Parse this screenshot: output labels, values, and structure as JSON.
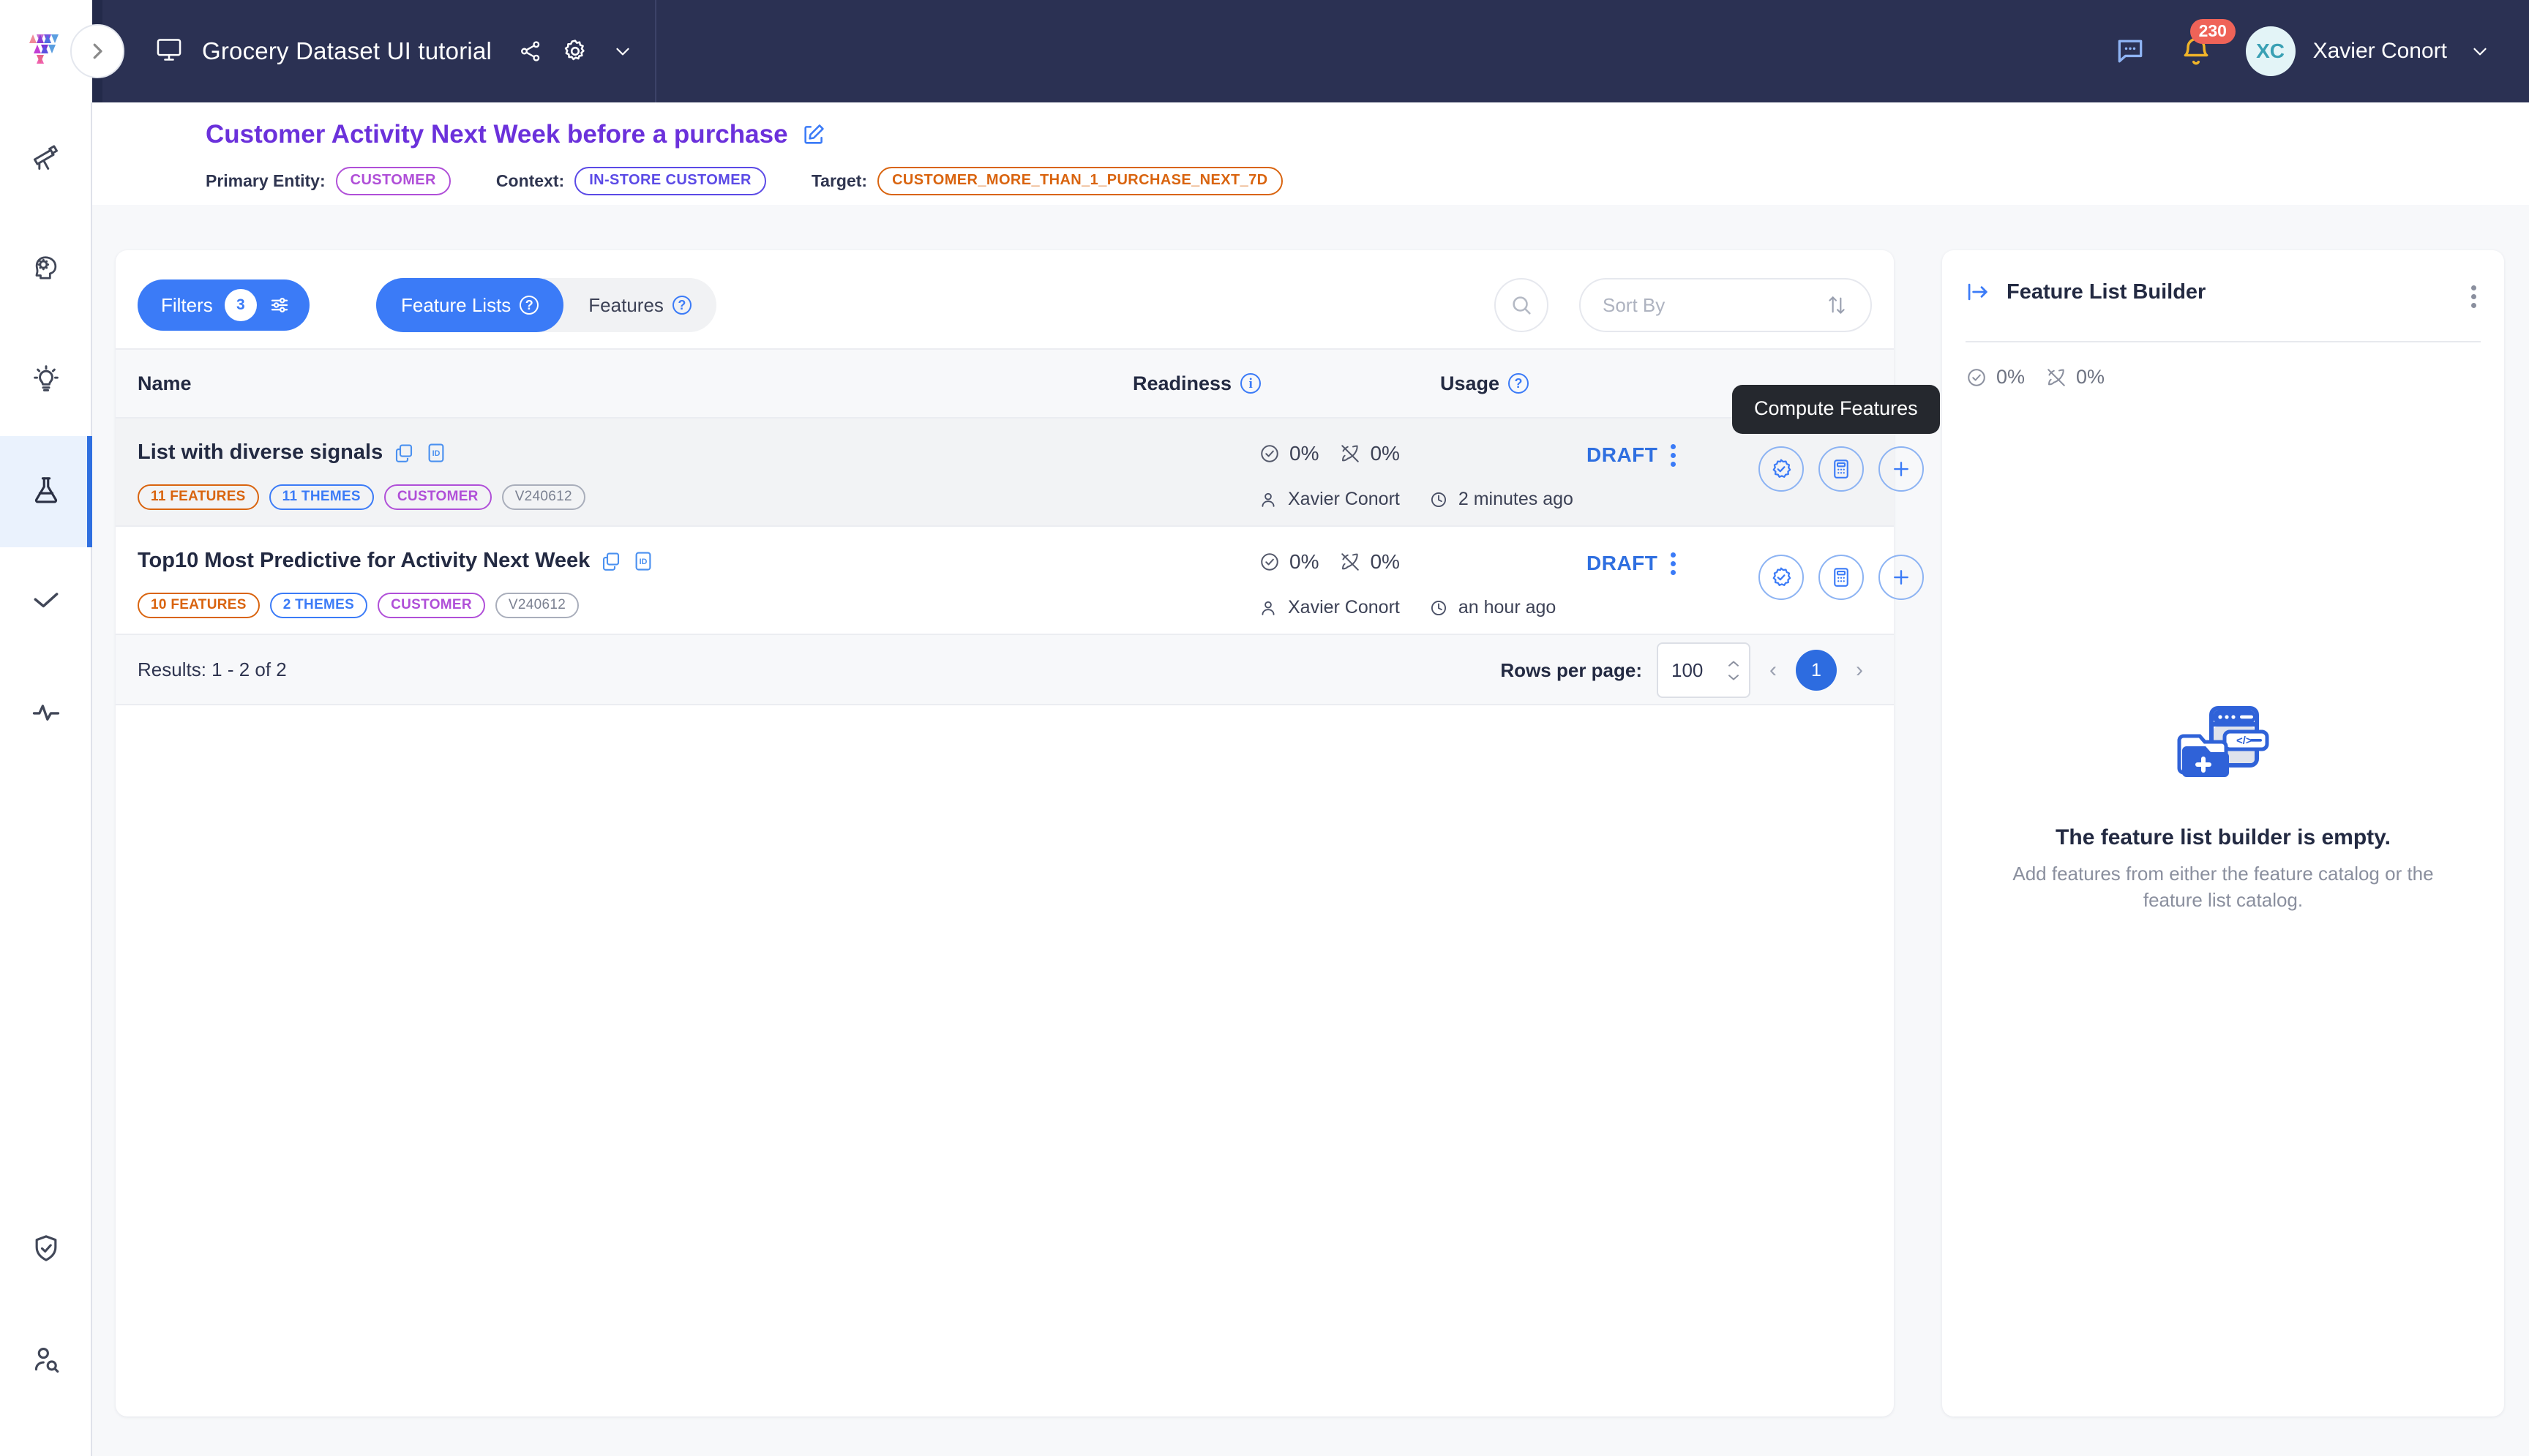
{
  "topbar": {
    "workspace_title": "Grocery Dataset UI tutorial",
    "monitor_icon": "monitor-icon",
    "share_icon": "share-icon",
    "settings_icon": "gear-icon",
    "caret_icon": "chevron-down-icon",
    "chat_icon": "chat-bubble-icon",
    "bell_icon": "bell-icon",
    "notification_count": "230",
    "avatar_initials": "XC",
    "user_name": "Xavier Conort",
    "bg_color": "#2b3153"
  },
  "rail": {
    "items": [
      {
        "icon": "telescope-icon",
        "active": false
      },
      {
        "icon": "brain-gear-icon",
        "active": false
      },
      {
        "icon": "lightbulb-icon",
        "active": false
      },
      {
        "icon": "flask-icon",
        "active": true
      },
      {
        "icon": "checkmark-icon",
        "active": false
      },
      {
        "icon": "pulse-icon",
        "active": false
      }
    ],
    "bottom_items": [
      {
        "icon": "shield-check-icon",
        "active": false
      },
      {
        "icon": "user-search-icon",
        "active": false
      }
    ]
  },
  "page_header": {
    "title": "Customer Activity Next Week before a purchase",
    "edit_icon": "edit-pencil-icon",
    "title_color": "#6b31db",
    "meta": [
      {
        "label": "Primary Entity:",
        "value": "CUSTOMER",
        "color": "#b04fd8"
      },
      {
        "label": "Context:",
        "value": "IN-STORE CUSTOMER",
        "color": "#5b4ae6"
      },
      {
        "label": "Target:",
        "value": "CUSTOMER_MORE_THAN_1_PURCHASE_NEXT_7D",
        "color": "#d9640f"
      }
    ]
  },
  "toolbar": {
    "filters_label": "Filters",
    "filters_count": "3",
    "filters_icon": "sliders-icon",
    "tabs": [
      {
        "label": "Feature Lists",
        "active": true,
        "help_icon": "question-circle-icon"
      },
      {
        "label": "Features",
        "active": false,
        "help_icon": "question-circle-icon"
      }
    ],
    "search_icon": "search-icon",
    "sort_placeholder": "Sort By",
    "sort_icon": "sort-arrows-icon",
    "accent_color": "#3b7bf7"
  },
  "table": {
    "columns": [
      {
        "label": "Name",
        "info_icon": null
      },
      {
        "label": "Readiness",
        "info_icon": "info-circle-icon"
      },
      {
        "label": "Usage",
        "info_icon": "question-circle-icon"
      }
    ],
    "rows": [
      {
        "name": "List with diverse signals",
        "copy_icon": "copy-icon",
        "id_icon": "id-badge-icon",
        "tags": [
          {
            "text": "11 FEATURES",
            "kind": "features"
          },
          {
            "text": "11 THEMES",
            "kind": "themes"
          },
          {
            "text": "CUSTOMER",
            "kind": "entity"
          },
          {
            "text": "V240612",
            "kind": "version"
          }
        ],
        "readiness": "0%",
        "readiness_icon": "check-circle-icon",
        "usage": "0%",
        "usage_icon": "rocket-off-icon",
        "status": "DRAFT",
        "author": "Xavier Conort",
        "author_icon": "person-icon",
        "time": "2 minutes ago",
        "time_icon": "clock-icon",
        "actions": [
          {
            "icon": "verified-badge-icon",
            "name": "validate-features-button"
          },
          {
            "icon": "calculator-icon",
            "name": "compute-features-button"
          },
          {
            "icon": "plus-icon",
            "name": "add-to-builder-button"
          }
        ],
        "highlighted": true
      },
      {
        "name": "Top10 Most Predictive for Activity Next Week",
        "copy_icon": "copy-icon",
        "id_icon": "id-badge-icon",
        "tags": [
          {
            "text": "10 FEATURES",
            "kind": "features"
          },
          {
            "text": "2 THEMES",
            "kind": "themes"
          },
          {
            "text": "CUSTOMER",
            "kind": "entity"
          },
          {
            "text": "V240612",
            "kind": "version"
          }
        ],
        "readiness": "0%",
        "readiness_icon": "check-circle-icon",
        "usage": "0%",
        "usage_icon": "rocket-off-icon",
        "status": "DRAFT",
        "author": "Xavier Conort",
        "author_icon": "person-icon",
        "time": "an hour ago",
        "time_icon": "clock-icon",
        "actions": [
          {
            "icon": "verified-badge-icon",
            "name": "validate-features-button"
          },
          {
            "icon": "calculator-icon",
            "name": "compute-features-button"
          },
          {
            "icon": "plus-icon",
            "name": "add-to-builder-button"
          }
        ],
        "highlighted": false
      }
    ],
    "tooltip": "Compute Features",
    "footer": {
      "results": "Results: 1 - 2 of 2",
      "rows_per_page_label": "Rows per page:",
      "rows_per_page_value": "100",
      "prev_icon": "chevron-left-icon",
      "next_icon": "chevron-right-icon",
      "current_page": "1"
    }
  },
  "builder": {
    "collapse_icon": "panel-collapse-icon",
    "title": "Feature List Builder",
    "kebab_icon": "more-vertical-icon",
    "readiness": "0%",
    "readiness_icon": "check-circle-icon",
    "usage": "0%",
    "usage_icon": "rocket-off-icon",
    "empty_illustration": "empty-folder-code-icon",
    "empty_title": "The feature list builder is empty.",
    "empty_subtitle": "Add features from either the feature catalog or the feature list catalog."
  }
}
